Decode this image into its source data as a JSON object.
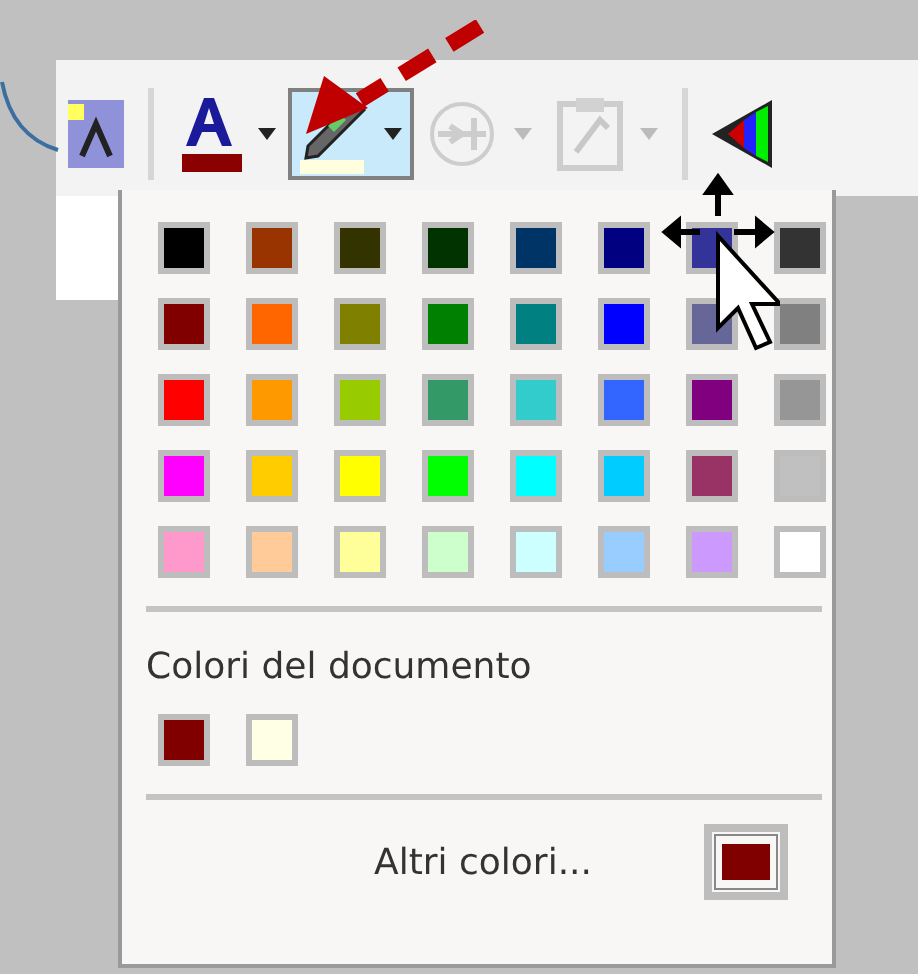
{
  "toolbar": {
    "buttons": [
      {
        "kind": "styles",
        "selected": false,
        "disabled": false,
        "dropdown": false
      },
      {
        "kind": "font-color",
        "selected": false,
        "disabled": false,
        "dropdown": true
      },
      {
        "kind": "highlight",
        "selected": true,
        "disabled": false,
        "dropdown": true
      },
      {
        "kind": "chart",
        "selected": false,
        "disabled": true,
        "dropdown": true
      },
      {
        "kind": "clipboard",
        "selected": false,
        "disabled": true,
        "dropdown": true
      },
      {
        "kind": "gradient",
        "selected": false,
        "disabled": false,
        "dropdown": false
      }
    ]
  },
  "palette": {
    "rows": [
      [
        {
          "color": "#000000"
        },
        {
          "color": "#993300"
        },
        {
          "color": "#333300"
        },
        {
          "color": "#003300"
        },
        {
          "color": "#003366"
        },
        {
          "color": "#000080"
        },
        {
          "color": "#333399"
        },
        {
          "color": "#333333"
        }
      ],
      [
        {
          "color": "#800000"
        },
        {
          "color": "#ff6600"
        },
        {
          "color": "#808000"
        },
        {
          "color": "#008000"
        },
        {
          "color": "#008080"
        },
        {
          "color": "#0000ff"
        },
        {
          "color": "#666699"
        },
        {
          "color": "#808080"
        }
      ],
      [
        {
          "color": "#ff0000"
        },
        {
          "color": "#ff9900"
        },
        {
          "color": "#99cc00"
        },
        {
          "color": "#339966"
        },
        {
          "color": "#33cccc"
        },
        {
          "color": "#3366ff"
        },
        {
          "color": "#800080"
        },
        {
          "color": "#969696"
        }
      ],
      [
        {
          "color": "#ff00ff"
        },
        {
          "color": "#ffcc00"
        },
        {
          "color": "#ffff00"
        },
        {
          "color": "#00ff00"
        },
        {
          "color": "#00ffff"
        },
        {
          "color": "#00ccff"
        },
        {
          "color": "#993366"
        },
        {
          "color": "#c0c0c0"
        }
      ],
      [
        {
          "color": "#ff99cc"
        },
        {
          "color": "#ffcc99"
        },
        {
          "color": "#ffff99"
        },
        {
          "color": "#ccffcc"
        },
        {
          "color": "#ccffff"
        },
        {
          "color": "#99ccff"
        },
        {
          "color": "#cc99ff"
        },
        {
          "color": "#ffffff"
        }
      ]
    ]
  },
  "document_colors": {
    "title": "Colori del documento",
    "swatches": [
      {
        "color": "#800000"
      },
      {
        "color": "#ffffe6"
      }
    ]
  },
  "more_colors": {
    "label": "Altri colori...",
    "color": "#800000"
  }
}
